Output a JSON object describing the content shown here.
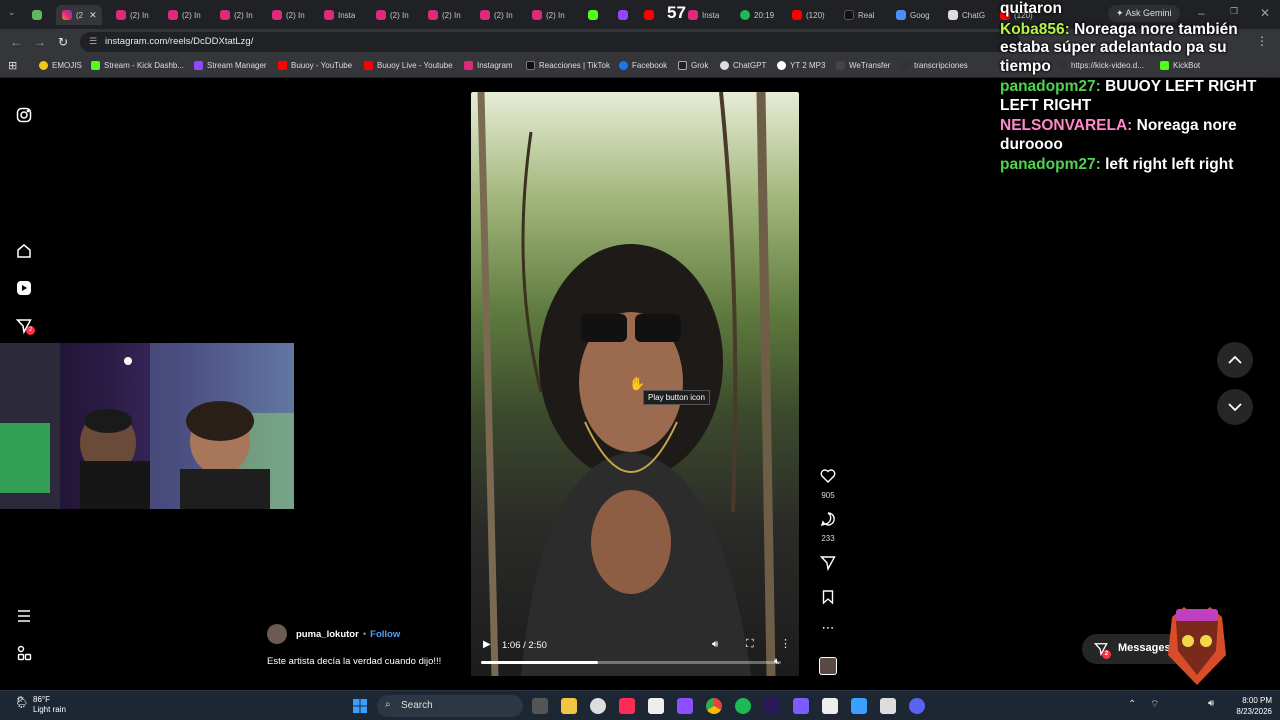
{
  "browser": {
    "tabs": [
      {
        "label": "(2",
        "active": true
      },
      {
        "label": "(2) In"
      },
      {
        "label": "(2) In"
      },
      {
        "label": "(2) In"
      },
      {
        "label": "(2) In"
      },
      {
        "label": "(2) In"
      },
      {
        "label": "Insta"
      },
      {
        "label": "(2) In"
      },
      {
        "label": "(2) In"
      },
      {
        "label": "(2) In"
      },
      {
        "label": "(2) In"
      },
      {
        "label": "57"
      },
      {
        "label": "Insta"
      },
      {
        "label": "20:19"
      },
      {
        "label": "(120)"
      },
      {
        "label": "Real"
      },
      {
        "label": "Goog"
      },
      {
        "label": "ChatG"
      },
      {
        "label": "(120)"
      }
    ],
    "ask_gemini": "Ask Gemini",
    "url": "instagram.com/reels/DcDDXtatLzg/",
    "bookmarks": [
      "EMOJIS",
      "Stream - Kick Dashb...",
      "Stream Manager",
      "Buuoy - YouTube",
      "Buuoy Live - Youtube",
      "Instagram",
      "Reacciones | TikTok",
      "Facebook",
      "Grok",
      "ChatGPT",
      "YT 2 MP3",
      "WeTransfer",
      "transcripciones",
      "https://kick-video.d...",
      "KickBot"
    ]
  },
  "sidebar": {
    "notifications_badge": "2",
    "messages_badge": "2"
  },
  "reel": {
    "tooltip": "Play button icon",
    "time": "1:06 / 2:50",
    "progress": 0.39,
    "likes": "905",
    "comments": "233",
    "author": "puma_lokutor",
    "separator": "•",
    "follow": "Follow",
    "caption": "Este artista decía la verdad cuando dijo!!!"
  },
  "messages_button": "Messages",
  "chat": [
    {
      "user": "",
      "text": "quitaron",
      "color": "#ffffff"
    },
    {
      "user": "Koba856:",
      "text": "Noreaga nore también estaba súper adelantado pa su tiempo",
      "color": "#b6f24a"
    },
    {
      "user": "panadopm27:",
      "text": "BUUOY LEFT RIGHT LEFT RIGHT",
      "color": "#4fd24f"
    },
    {
      "user": "NELSONVARELA:",
      "text": "Noreaga nore duroooo",
      "color": "#ff88c8"
    },
    {
      "user": "panadopm27:",
      "text": "left right left right",
      "color": "#4fd24f"
    }
  ],
  "taskbar": {
    "temperature": "86°F",
    "weather": "Light rain",
    "search": "Search",
    "time": "8:00 PM",
    "date": "8/23/2026"
  }
}
